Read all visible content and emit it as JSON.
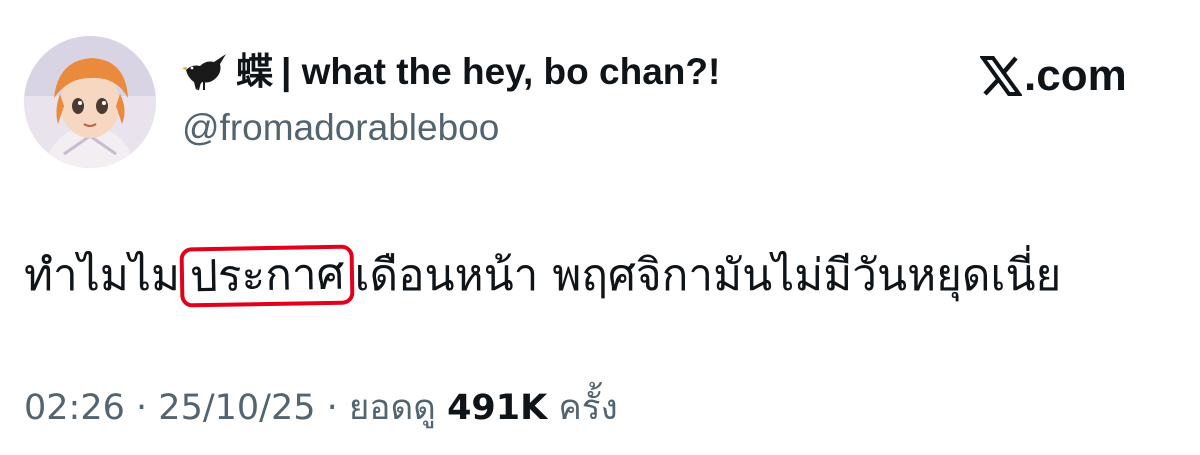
{
  "author": {
    "display_emoji": "蝶",
    "display_name": "| what the hey, bo chan?!",
    "handle": "@fromadorableboo"
  },
  "brand": {
    "label": ".com"
  },
  "tweet": {
    "text_before": "ทำไมไม",
    "text_highlighted": "ประกาศ",
    "text_after": "เดือนหน้า พฤศจิกามันไม่มีวันหยุดเนี่ย",
    "highlight_color": "#e3001b"
  },
  "meta": {
    "time": "02:26",
    "date": "25/10/25",
    "views_label": "ยอดดู",
    "views_count": "491K",
    "views_suffix": "ครั้ง"
  },
  "icons": {
    "bird": "blackbird-icon",
    "brand": "x-logo-icon"
  },
  "colors": {
    "text_primary": "#0f1419",
    "text_secondary": "#536471"
  }
}
